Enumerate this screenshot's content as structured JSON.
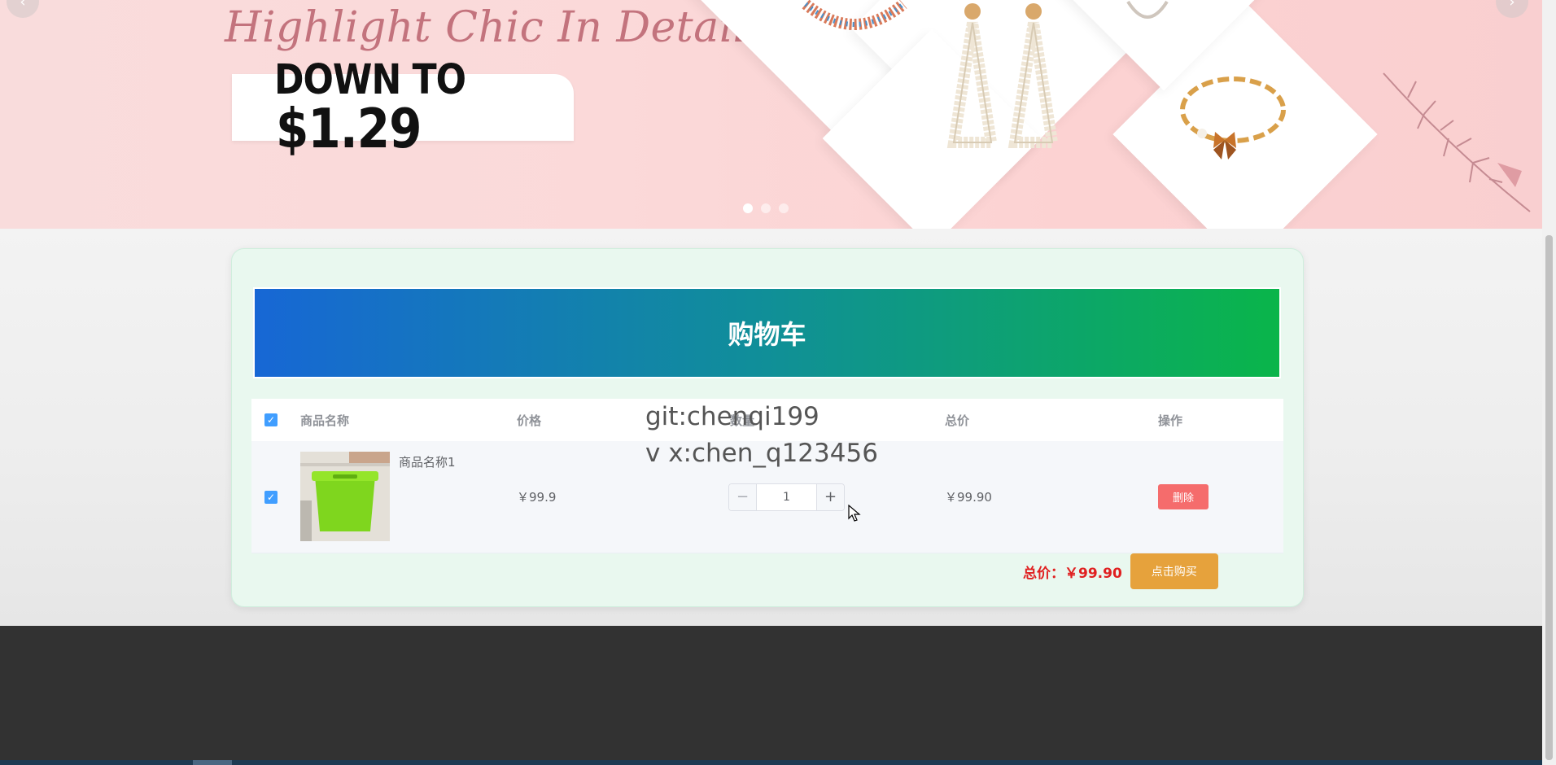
{
  "banner": {
    "title": "Highlight Chic In Details",
    "promo_prefix": "DOWN TO",
    "promo_price": "$1.29",
    "prev_icon": "‹",
    "next_icon": "›",
    "active_slide": 1,
    "slide_count": 3
  },
  "cart": {
    "title": "购物车",
    "columns": {
      "name": "商品名称",
      "price": "价格",
      "quantity": "数量",
      "total": "总价",
      "operation": "操作"
    },
    "items": [
      {
        "name": "商品名称1",
        "price": "￥99.9",
        "quantity": "1",
        "subtotal": "￥99.90",
        "delete_label": "删除",
        "checked": true
      }
    ],
    "select_all_checked": true,
    "summary_label": "总价：",
    "summary_value": "￥99.90",
    "buy_label": "点击购买"
  },
  "watermark": {
    "line1": "git:chenqi199",
    "line2": "v x:chen_q123456"
  },
  "colors": {
    "header_gradient_start": "#1767d5",
    "header_gradient_end": "#0ab54a",
    "delete_button": "#f56c6c",
    "buy_button": "#e6a23c",
    "total_text": "#e02020",
    "footer": "#323232"
  }
}
